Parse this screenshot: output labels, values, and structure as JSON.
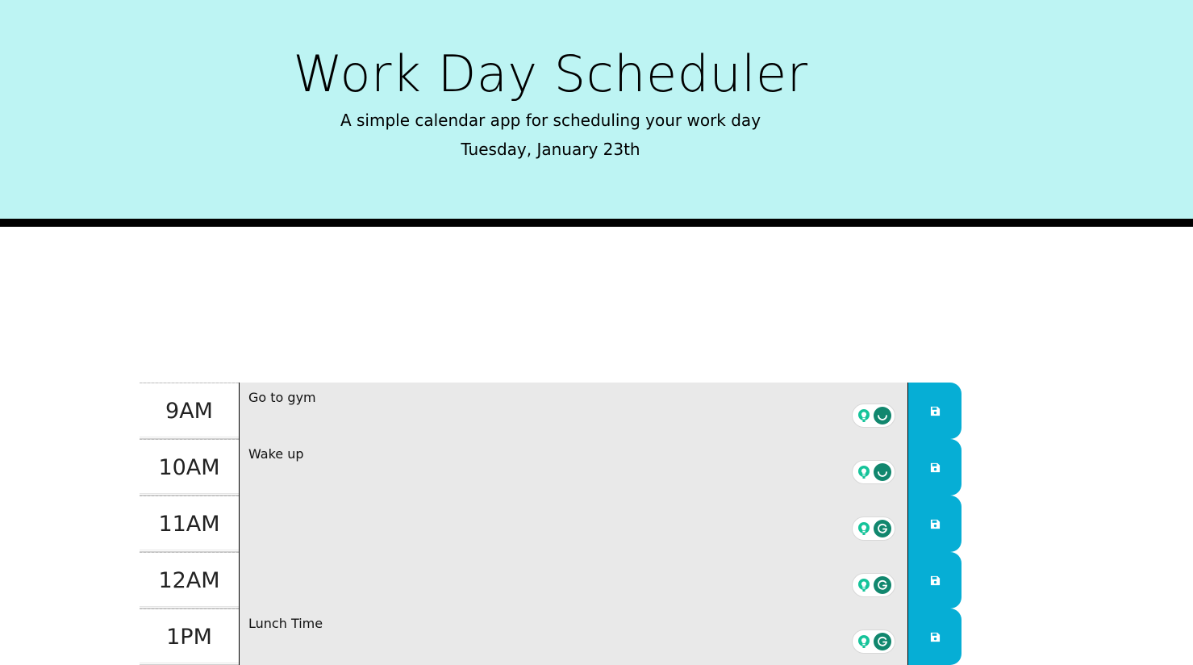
{
  "header": {
    "title": "Work Day Scheduler",
    "subtitle": "A simple calendar app for scheduling your work day",
    "current_day": "Tuesday, January 23th"
  },
  "rows": [
    {
      "hour": "9AM",
      "description": "Go to gym",
      "grammarly_state": "loading"
    },
    {
      "hour": "10AM",
      "description": "Wake up",
      "grammarly_state": "loading"
    },
    {
      "hour": "11AM",
      "description": "",
      "grammarly_state": "ready"
    },
    {
      "hour": "12AM",
      "description": "",
      "grammarly_state": "ready"
    },
    {
      "hour": "1PM",
      "description": "Lunch Time",
      "grammarly_state": "ready"
    }
  ],
  "icons": {
    "save": "floppy-disk-icon",
    "bulb": "lightbulb-icon",
    "grammarly": "grammarly-icon"
  },
  "colors": {
    "header_bg": "#bdf4f3",
    "save_bg": "#06aed5",
    "past_bg": "#e9e9e9",
    "grammarly_green": "#11876e"
  }
}
